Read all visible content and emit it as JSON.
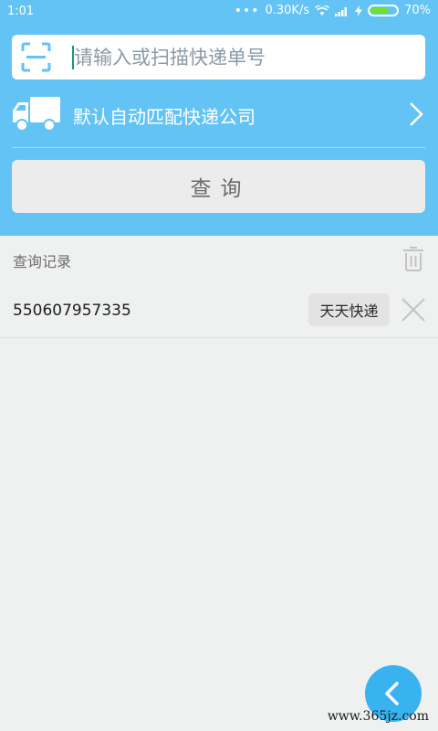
{
  "status_bar": {
    "time": "1:01",
    "network_speed": "0.30K/s",
    "battery_percent": "70%",
    "battery_level": 0.7
  },
  "search": {
    "placeholder": "请输入或扫描快递单号"
  },
  "company_selector": {
    "label": "默认自动匹配快递公司"
  },
  "query_button": {
    "label": "查询"
  },
  "history": {
    "title": "查询记录",
    "records": [
      {
        "number": "550607957335",
        "company": "天天快递"
      }
    ]
  },
  "watermark": "www.365jz.com",
  "colors": {
    "header": "#63c3f5",
    "fab": "#38b3ef",
    "background": "#eff0f0"
  }
}
